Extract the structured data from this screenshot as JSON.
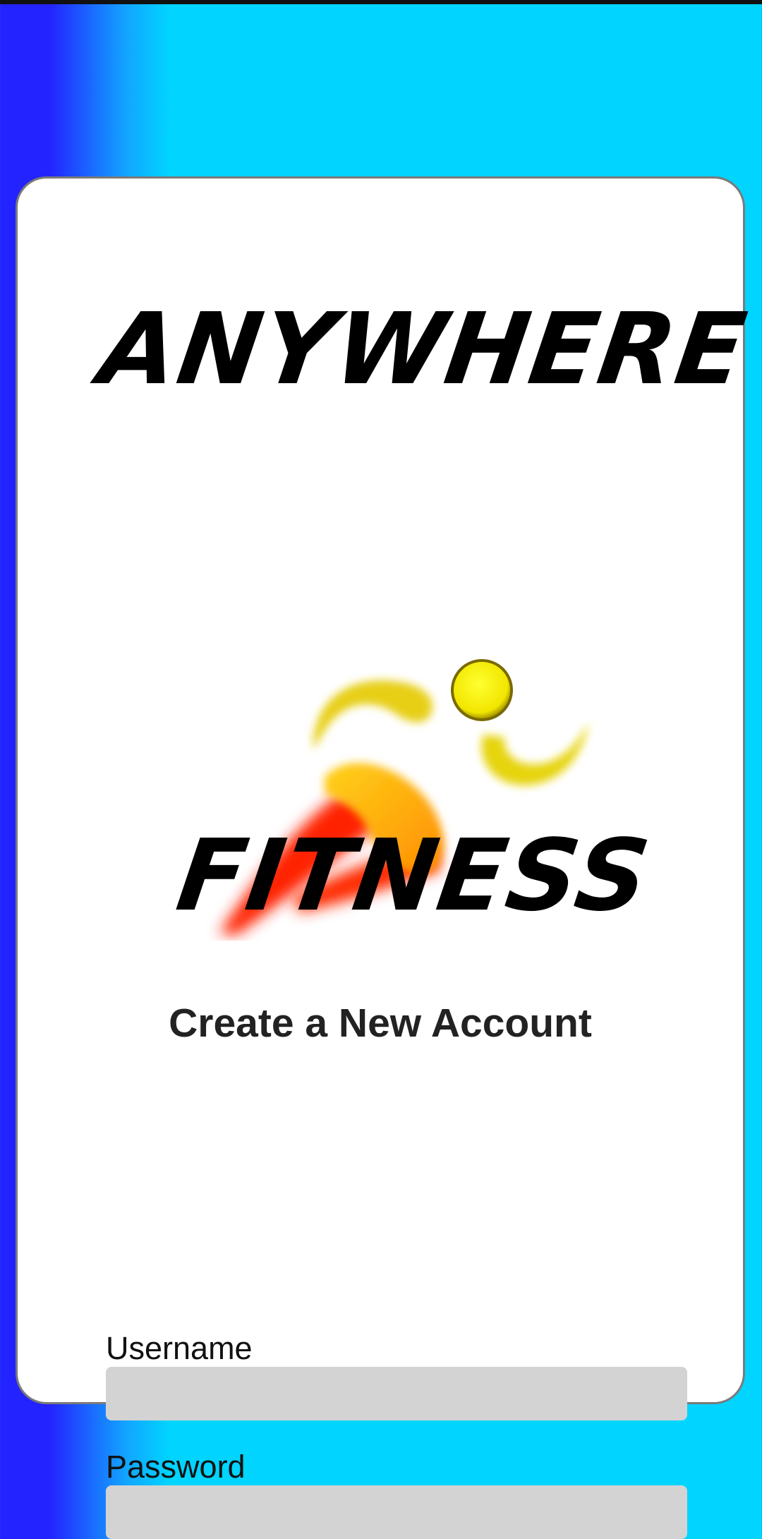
{
  "brand": {
    "line1": "ANYWHERE",
    "line2": "FITNESS",
    "logo_icon": "running-person-icon"
  },
  "form": {
    "title": "Create a New Account",
    "username": {
      "label": "Username",
      "value": "",
      "placeholder": ""
    },
    "password": {
      "label": "Password",
      "value": "",
      "placeholder": ""
    }
  },
  "colors": {
    "background_left": "#2323ff",
    "background_right": "#00d4ff",
    "card": "#ffffff",
    "card_border": "#7a7a7a",
    "input_fill": "#d3d3d3",
    "logo_yellow": "#e6d20a",
    "logo_red": "#ff2a00"
  }
}
